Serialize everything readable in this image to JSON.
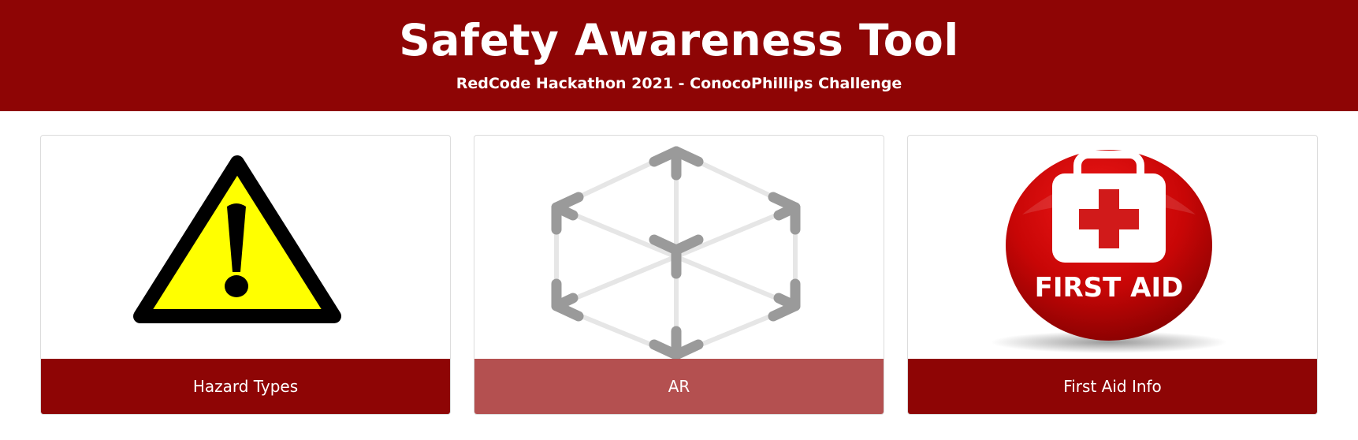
{
  "header": {
    "title": "Safety Awareness Tool",
    "subtitle": "RedCode Hackathon 2021 - ConocoPhillips Challenge",
    "background_color": "#8e0505"
  },
  "cards": [
    {
      "label": "Hazard Types",
      "icon": "warning-triangle-icon",
      "button_color": "#8e0505"
    },
    {
      "label": "AR",
      "icon": "ar-cube-icon",
      "button_color": "#b45050",
      "state": "dimmed"
    },
    {
      "label": "First Aid Info",
      "icon": "first-aid-kit-icon",
      "icon_text": "FIRST AID",
      "button_color": "#8e0505"
    }
  ]
}
